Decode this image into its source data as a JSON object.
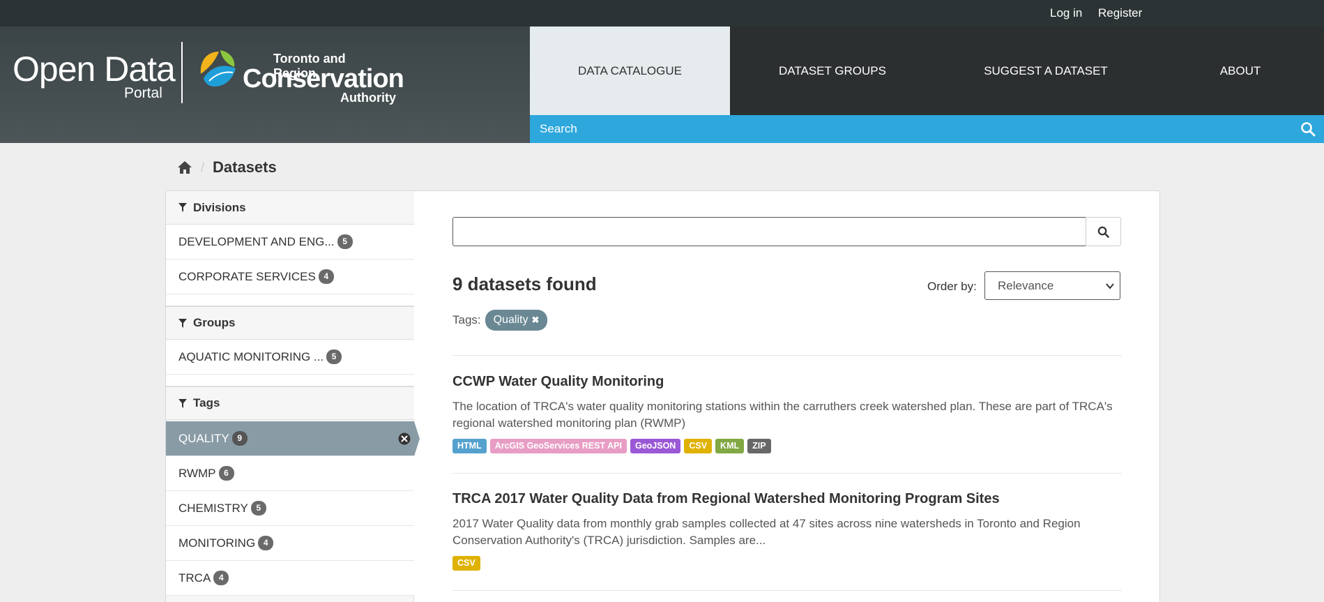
{
  "account": {
    "login": "Log in",
    "register": "Register"
  },
  "logo": {
    "open_data": "Open Data",
    "portal": "Portal",
    "org_line1": "Toronto and Region",
    "org_line2": "Conservation",
    "org_line3": "Authority"
  },
  "nav": [
    {
      "label": "DATA CATALOGUE",
      "active": true
    },
    {
      "label": "DATASET GROUPS",
      "active": false
    },
    {
      "label": "SUGGEST A DATASET",
      "active": false
    },
    {
      "label": "ABOUT",
      "active": false
    }
  ],
  "site_search": {
    "placeholder": "Search",
    "icon": "search-icon"
  },
  "breadcrumb": {
    "home_icon": "home-icon",
    "current": "Datasets"
  },
  "facets": {
    "divisions": {
      "title": "Divisions",
      "items": [
        {
          "label": "DEVELOPMENT AND ENG...",
          "count": "5"
        },
        {
          "label": "CORPORATE SERVICES",
          "count": "4"
        }
      ]
    },
    "groups": {
      "title": "Groups",
      "items": [
        {
          "label": "AQUATIC MONITORING ...",
          "count": "5"
        }
      ]
    },
    "tags": {
      "title": "Tags",
      "items": [
        {
          "label": "QUALITY",
          "count": "9",
          "active": true
        },
        {
          "label": "RWMP",
          "count": "6"
        },
        {
          "label": "CHEMISTRY",
          "count": "5"
        },
        {
          "label": "MONITORING",
          "count": "4"
        },
        {
          "label": "TRCA",
          "count": "4"
        }
      ]
    }
  },
  "search": {
    "value": "",
    "button_icon": "search-icon"
  },
  "results": {
    "count_text": "9 datasets found",
    "order_label": "Order by:",
    "order_selected": "Relevance",
    "tags_label": "Tags:",
    "active_tag": "Quality"
  },
  "datasets": [
    {
      "title": "CCWP Water Quality Monitoring",
      "notes": "The location of TRCA's water quality monitoring stations within the carruthers creek watershed plan. These are part of TRCA's regional watershed monitoring plan (RWMP)",
      "formats": [
        {
          "label": "HTML",
          "color": "#55a1ce"
        },
        {
          "label": "ArcGIS GeoServices REST API",
          "color": "#e89dc4"
        },
        {
          "label": "GeoJSON",
          "color": "#9a58d6"
        },
        {
          "label": "CSV",
          "color": "#dfb100"
        },
        {
          "label": "KML",
          "color": "#81a843"
        },
        {
          "label": "ZIP",
          "color": "#686868"
        }
      ]
    },
    {
      "title": "TRCA 2017 Water Quality Data from Regional Watershed Monitoring Program Sites",
      "notes": "2017 Water Quality data from monthly grab samples collected at 47 sites across nine watersheds in Toronto and Region Conservation Authority's (TRCA) jurisdiction. Samples are...",
      "formats": [
        {
          "label": "CSV",
          "color": "#dfb100"
        }
      ]
    }
  ],
  "colors": {
    "account_bar": "#2b3335",
    "nav_bg": "#2b2f30",
    "nav_active": "#e6ebee",
    "search_bar": "#2ea7dc",
    "active_facet": "#899ca6",
    "tag_pill": "#6a8894"
  }
}
